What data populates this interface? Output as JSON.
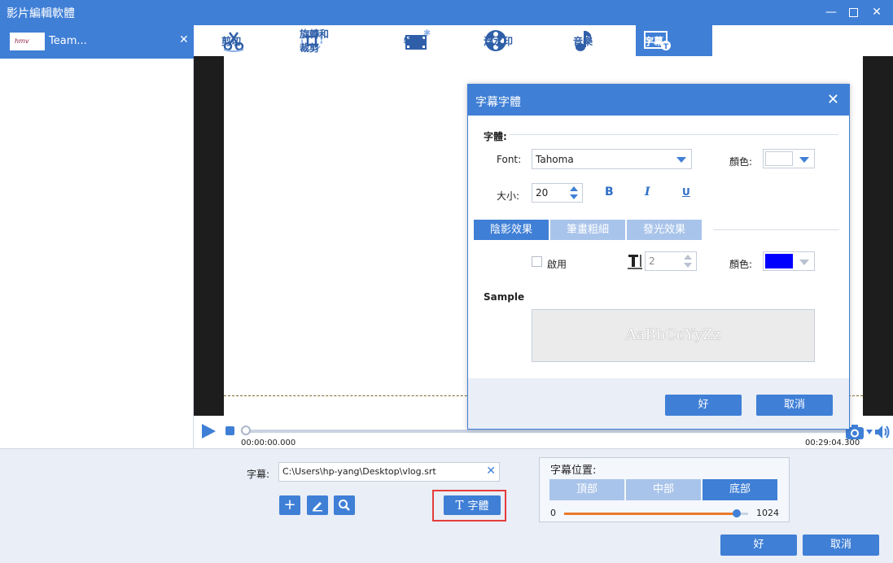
{
  "window": {
    "title": "影片編輯軟體"
  },
  "file": {
    "name": "Team...",
    "thumb_text": "hmv"
  },
  "tabs": [
    {
      "label": "剪切",
      "icon": "scissors-icon"
    },
    {
      "label": "旋轉和裁剪",
      "icon": "rotate-crop-icon"
    },
    {
      "label": "特效",
      "icon": "effects-icon"
    },
    {
      "label": "浮水印",
      "icon": "watermark-icon"
    },
    {
      "label": "音樂",
      "icon": "music-note-icon"
    },
    {
      "label": "字幕",
      "icon": "subtitle-icon"
    }
  ],
  "active_tab": "字幕",
  "player": {
    "time_start": "00:00:00.000",
    "time_end": "00:29:04.300",
    "progress": 0
  },
  "subtitle": {
    "label": "字幕:",
    "path": "C:\\Users\\hp-yang\\Desktop\\vlog.srt",
    "font_button": "字體"
  },
  "position": {
    "title": "字幕位置:",
    "options": [
      "頂部",
      "中部",
      "底部"
    ],
    "selected": "底部",
    "min": "0",
    "max": "1024",
    "value_fraction": 0.94
  },
  "footer": {
    "ok": "好",
    "cancel": "取消"
  },
  "dialog": {
    "title": "字幕字體",
    "section_font": "字體:",
    "font_label": "Font:",
    "font_value": "Tahoma",
    "color_label": "顏色:",
    "font_color": "#ffffff",
    "size_label": "大小:",
    "size_value": "20",
    "bold": "B",
    "italic": "I",
    "underline": "U",
    "effect_tabs": [
      "陰影效果",
      "筆畫粗細",
      "發光效果"
    ],
    "effect_selected": "陰影效果",
    "enable_label": "啟用",
    "effect_size": "2",
    "effect_color_label": "顏色:",
    "effect_color": "#0000ff",
    "sample_label": "Sample",
    "sample_text": "AaBbCcYyZz",
    "ok": "好",
    "cancel": "取消"
  },
  "colors": {
    "accent": "#3f7fd6",
    "highlight": "#e53c3c",
    "slider_fill": "#ec7a2a"
  }
}
